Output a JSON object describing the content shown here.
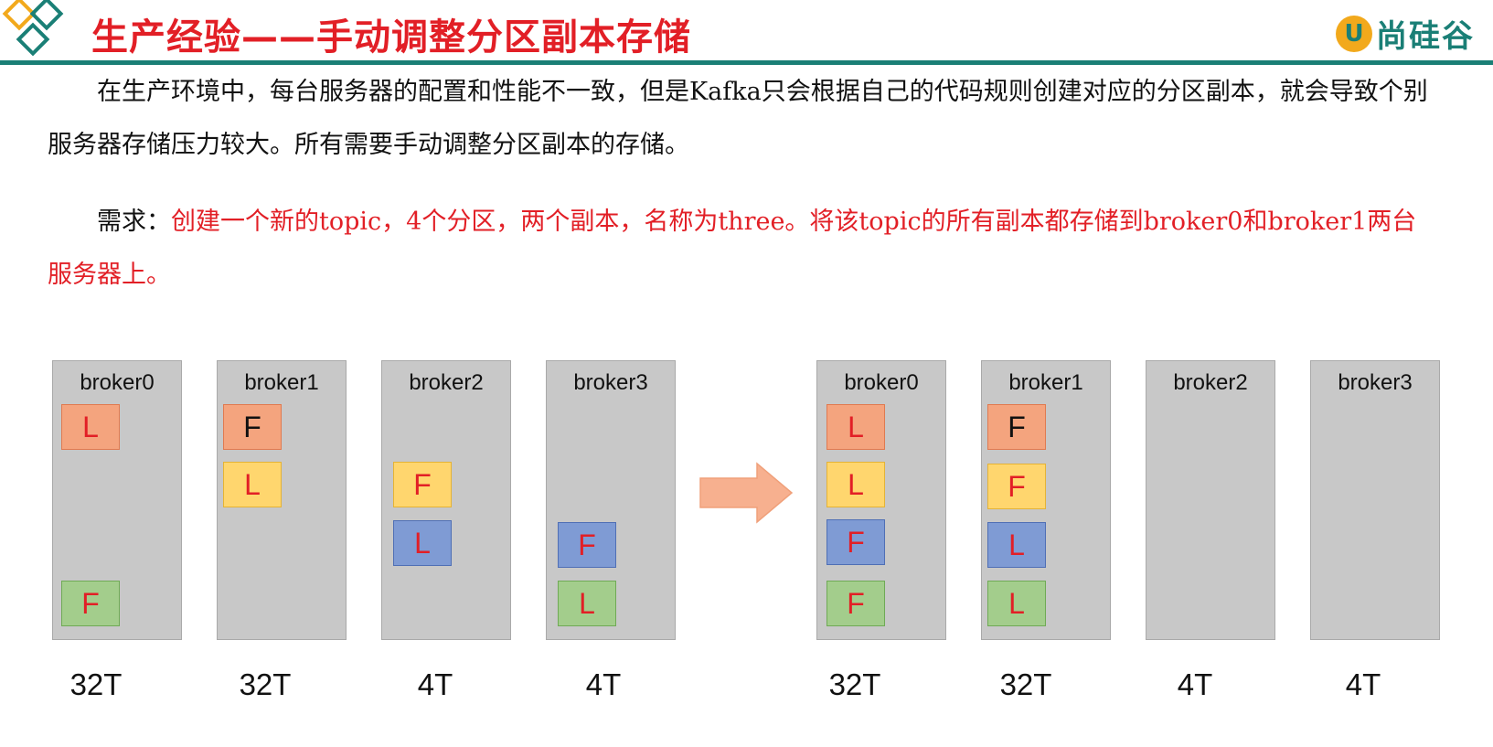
{
  "header": {
    "title": "生产经验——手动调整分区副本存储",
    "brand_mark": "U",
    "brand_text": "尚硅谷",
    "accent_color": "#1a7f76",
    "title_color": "#e21f26"
  },
  "intro": "在生产环境中，每台服务器的配置和性能不一致，但是Kafka只会根据自己的代码规则创建对应的分区副本，就会导致个别服务器存储压力较大。所有需要手动调整分区副本的存储。",
  "requirement": {
    "label": "需求：",
    "text": "创建一个新的topic，4个分区，两个副本，名称为three。将该topic的所有副本都存储到broker0和broker1两台服务器上。"
  },
  "before": {
    "brokers": [
      {
        "name": "broker0",
        "capacity": "32T",
        "replicas": [
          "L",
          "F"
        ]
      },
      {
        "name": "broker1",
        "capacity": "32T",
        "replicas": [
          "F",
          "L"
        ]
      },
      {
        "name": "broker2",
        "capacity": "4T",
        "replicas": [
          "F",
          "L"
        ]
      },
      {
        "name": "broker3",
        "capacity": "4T",
        "replicas": [
          "F",
          "L"
        ]
      }
    ]
  },
  "after": {
    "brokers": [
      {
        "name": "broker0",
        "capacity": "32T",
        "replicas": [
          "L",
          "L",
          "F",
          "F"
        ]
      },
      {
        "name": "broker1",
        "capacity": "32T",
        "replicas": [
          "F",
          "F",
          "L",
          "L"
        ]
      },
      {
        "name": "broker2",
        "capacity": "4T",
        "replicas": []
      },
      {
        "name": "broker3",
        "capacity": "4T",
        "replicas": []
      }
    ]
  },
  "colors": {
    "orange": "#f4a47e",
    "yellow": "#ffd66e",
    "blue": "#7f9bd4",
    "green": "#a3cd8c",
    "arrow": "#f7b08f"
  }
}
